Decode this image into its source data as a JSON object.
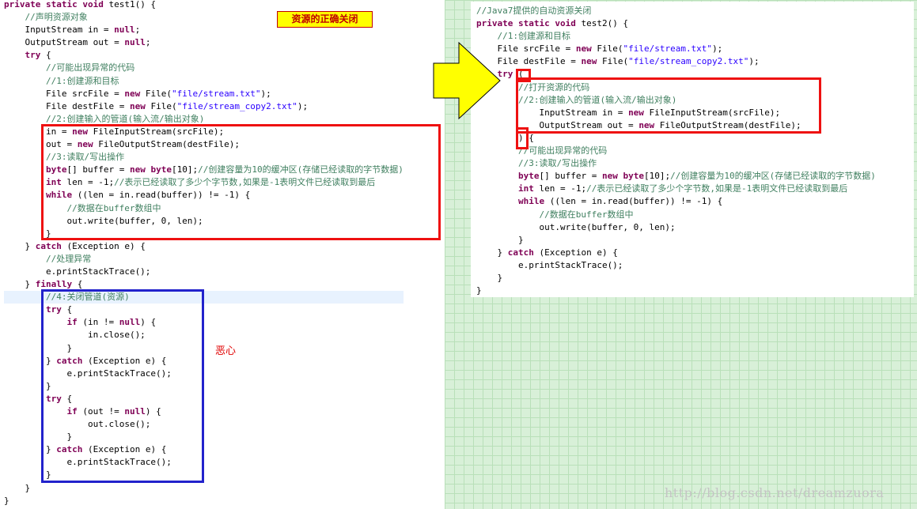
{
  "left_code": [
    [
      [
        "kw",
        "private static void "
      ],
      [
        "pl",
        "test1() {"
      ]
    ],
    [
      [
        "pl",
        "    "
      ],
      [
        "cm",
        "//声明资源对象"
      ]
    ],
    [
      [
        "pl",
        "    InputStream in = "
      ],
      [
        "kw",
        "null"
      ],
      [
        "pl",
        ";"
      ]
    ],
    [
      [
        "pl",
        "    OutputStream out = "
      ],
      [
        "kw",
        "null"
      ],
      [
        "pl",
        ";"
      ]
    ],
    [
      [
        "pl",
        "    "
      ],
      [
        "kw",
        "try"
      ],
      [
        "pl",
        " {"
      ]
    ],
    [
      [
        "pl",
        "        "
      ],
      [
        "cm",
        "//可能出现异常的代码"
      ]
    ],
    [
      [
        "pl",
        "        "
      ],
      [
        "cm",
        "//1:创建源和目标"
      ]
    ],
    [
      [
        "pl",
        "        File srcFile = "
      ],
      [
        "kw",
        "new"
      ],
      [
        "pl",
        " File("
      ],
      [
        "st",
        "\"file/stream.txt\""
      ],
      [
        "pl",
        ");"
      ]
    ],
    [
      [
        "pl",
        "        File destFile = "
      ],
      [
        "kw",
        "new"
      ],
      [
        "pl",
        " File("
      ],
      [
        "st",
        "\"file/stream_copy2.txt\""
      ],
      [
        "pl",
        ");"
      ]
    ],
    [
      [
        "pl",
        "        "
      ],
      [
        "cm",
        "//2:创建输入的管道(输入流/输出对象)"
      ]
    ],
    [
      [
        "pl",
        "        in = "
      ],
      [
        "kw",
        "new"
      ],
      [
        "pl",
        " FileInputStream(srcFile);"
      ]
    ],
    [
      [
        "pl",
        "        out = "
      ],
      [
        "kw",
        "new"
      ],
      [
        "pl",
        " FileOutputStream(destFile);"
      ]
    ],
    [
      [
        "pl",
        "        "
      ],
      [
        "cm",
        "//3:读取/写出操作"
      ]
    ],
    [
      [
        "pl",
        "        "
      ],
      [
        "kw",
        "byte"
      ],
      [
        "pl",
        "[] buffer = "
      ],
      [
        "kw",
        "new byte"
      ],
      [
        "pl",
        "[10];"
      ],
      [
        "cm",
        "//创建容量为10的缓冲区(存储已经读取的字节数据)"
      ]
    ],
    [
      [
        "pl",
        "        "
      ],
      [
        "kw",
        "int"
      ],
      [
        "pl",
        " len = -1;"
      ],
      [
        "cm",
        "//表示已经读取了多少个字节数,如果是-1表明文件已经读取到最后"
      ]
    ],
    [
      [
        "pl",
        "        "
      ],
      [
        "kw",
        "while"
      ],
      [
        "pl",
        " ((len = in.read(buffer)) != -1) {"
      ]
    ],
    [
      [
        "pl",
        "            "
      ],
      [
        "cm",
        "//数据在buffer数组中"
      ]
    ],
    [
      [
        "pl",
        "            out.write(buffer, 0, len);"
      ]
    ],
    [
      [
        "pl",
        "        }"
      ]
    ],
    [
      [
        "pl",
        "    } "
      ],
      [
        "kw",
        "catch"
      ],
      [
        "pl",
        " (Exception e) {"
      ]
    ],
    [
      [
        "pl",
        "        "
      ],
      [
        "cm",
        "//处理异常"
      ]
    ],
    [
      [
        "pl",
        "        e.printStackTrace();"
      ]
    ],
    [
      [
        "pl",
        "    } "
      ],
      [
        "kw",
        "finally"
      ],
      [
        "pl",
        " {"
      ]
    ],
    [
      [
        "pl",
        "        "
      ],
      [
        "cm",
        "//4:关闭管道(资源)"
      ]
    ],
    [
      [
        "pl",
        "        "
      ],
      [
        "kw",
        "try"
      ],
      [
        "pl",
        " {"
      ]
    ],
    [
      [
        "pl",
        "            "
      ],
      [
        "kw",
        "if"
      ],
      [
        "pl",
        " (in != "
      ],
      [
        "kw",
        "null"
      ],
      [
        "pl",
        ") {"
      ]
    ],
    [
      [
        "pl",
        "                in.close();"
      ]
    ],
    [
      [
        "pl",
        "            }"
      ]
    ],
    [
      [
        "pl",
        "        } "
      ],
      [
        "kw",
        "catch"
      ],
      [
        "pl",
        " (Exception e) {"
      ]
    ],
    [
      [
        "pl",
        "            e.printStackTrace();"
      ]
    ],
    [
      [
        "pl",
        "        }"
      ]
    ],
    [
      [
        "pl",
        "        "
      ],
      [
        "kw",
        "try"
      ],
      [
        "pl",
        " {"
      ]
    ],
    [
      [
        "pl",
        "            "
      ],
      [
        "kw",
        "if"
      ],
      [
        "pl",
        " (out != "
      ],
      [
        "kw",
        "null"
      ],
      [
        "pl",
        ") {"
      ]
    ],
    [
      [
        "pl",
        "                out.close();"
      ]
    ],
    [
      [
        "pl",
        "            }"
      ]
    ],
    [
      [
        "pl",
        "        } "
      ],
      [
        "kw",
        "catch"
      ],
      [
        "pl",
        " (Exception e) {"
      ]
    ],
    [
      [
        "pl",
        "            e.printStackTrace();"
      ]
    ],
    [
      [
        "pl",
        "        }"
      ]
    ],
    [
      [
        "pl",
        "    }"
      ]
    ],
    [
      [
        "pl",
        "}"
      ]
    ]
  ],
  "right_code": [
    [
      [
        "cm",
        "//Java7提供的自动资源关闭"
      ]
    ],
    [
      [
        "kw",
        "private static void "
      ],
      [
        "pl",
        "test2() {"
      ]
    ],
    [
      [
        "pl",
        "    "
      ],
      [
        "cm",
        "//1:创建源和目标"
      ]
    ],
    [
      [
        "pl",
        "    File srcFile = "
      ],
      [
        "kw",
        "new"
      ],
      [
        "pl",
        " File("
      ],
      [
        "st",
        "\"file/stream.txt\""
      ],
      [
        "pl",
        ");"
      ]
    ],
    [
      [
        "pl",
        "    File destFile = "
      ],
      [
        "kw",
        "new"
      ],
      [
        "pl",
        " File("
      ],
      [
        "st",
        "\"file/stream_copy2.txt\""
      ],
      [
        "pl",
        ");"
      ]
    ],
    [
      [
        "pl",
        "    "
      ],
      [
        "kw",
        "try"
      ],
      [
        "pl",
        " ("
      ]
    ],
    [
      [
        "pl",
        "        "
      ],
      [
        "cm",
        "//打开资源的代码"
      ]
    ],
    [
      [
        "pl",
        "        "
      ],
      [
        "cm",
        "//2:创建输入的管道(输入流/输出对象)"
      ]
    ],
    [
      [
        "pl",
        "            InputStream in = "
      ],
      [
        "kw",
        "new"
      ],
      [
        "pl",
        " FileInputStream(srcFile);"
      ]
    ],
    [
      [
        "pl",
        "            OutputStream out = "
      ],
      [
        "kw",
        "new"
      ],
      [
        "pl",
        " FileOutputStream(destFile);"
      ]
    ],
    [
      [
        "pl",
        "        ) {"
      ]
    ],
    [
      [
        "pl",
        "        "
      ],
      [
        "cm",
        "//可能出现异常的代码"
      ]
    ],
    [
      [
        "pl",
        "        "
      ],
      [
        "cm",
        "//3:读取/写出操作"
      ]
    ],
    [
      [
        "pl",
        "        "
      ],
      [
        "kw",
        "byte"
      ],
      [
        "pl",
        "[] buffer = "
      ],
      [
        "kw",
        "new byte"
      ],
      [
        "pl",
        "[10];"
      ],
      [
        "cm",
        "//创建容量为10的缓冲区(存储已经读取的字节数据)"
      ]
    ],
    [
      [
        "pl",
        "        "
      ],
      [
        "kw",
        "int"
      ],
      [
        "pl",
        " len = -1;"
      ],
      [
        "cm",
        "//表示已经读取了多少个字节数,如果是-1表明文件已经读取到最后"
      ]
    ],
    [
      [
        "pl",
        "        "
      ],
      [
        "kw",
        "while"
      ],
      [
        "pl",
        " ((len = in.read(buffer)) != -1) {"
      ]
    ],
    [
      [
        "pl",
        "            "
      ],
      [
        "cm",
        "//数据在buffer数组中"
      ]
    ],
    [
      [
        "pl",
        "            out.write(buffer, 0, len);"
      ]
    ],
    [
      [
        "pl",
        "        }"
      ]
    ],
    [
      [
        "pl",
        "    } "
      ],
      [
        "kw",
        "catch"
      ],
      [
        "pl",
        " (Exception e) {"
      ]
    ],
    [
      [
        "pl",
        "        e.printStackTrace();"
      ]
    ],
    [
      [
        "pl",
        "    }"
      ]
    ],
    [
      [
        "pl",
        "}"
      ]
    ]
  ],
  "annotations": {
    "title_badge": "资源的正确关闭",
    "note": "恶心",
    "watermark": "http://blog.csdn.net/dreamzuora"
  },
  "colors": {
    "keyword": "#7f0055",
    "comment": "#3f7f5f",
    "string": "#2a00ff",
    "red_box": "#ee1111",
    "blue_box": "#2222cc",
    "arrow": "#ffff00",
    "grid_background": "#d8f0d8"
  }
}
